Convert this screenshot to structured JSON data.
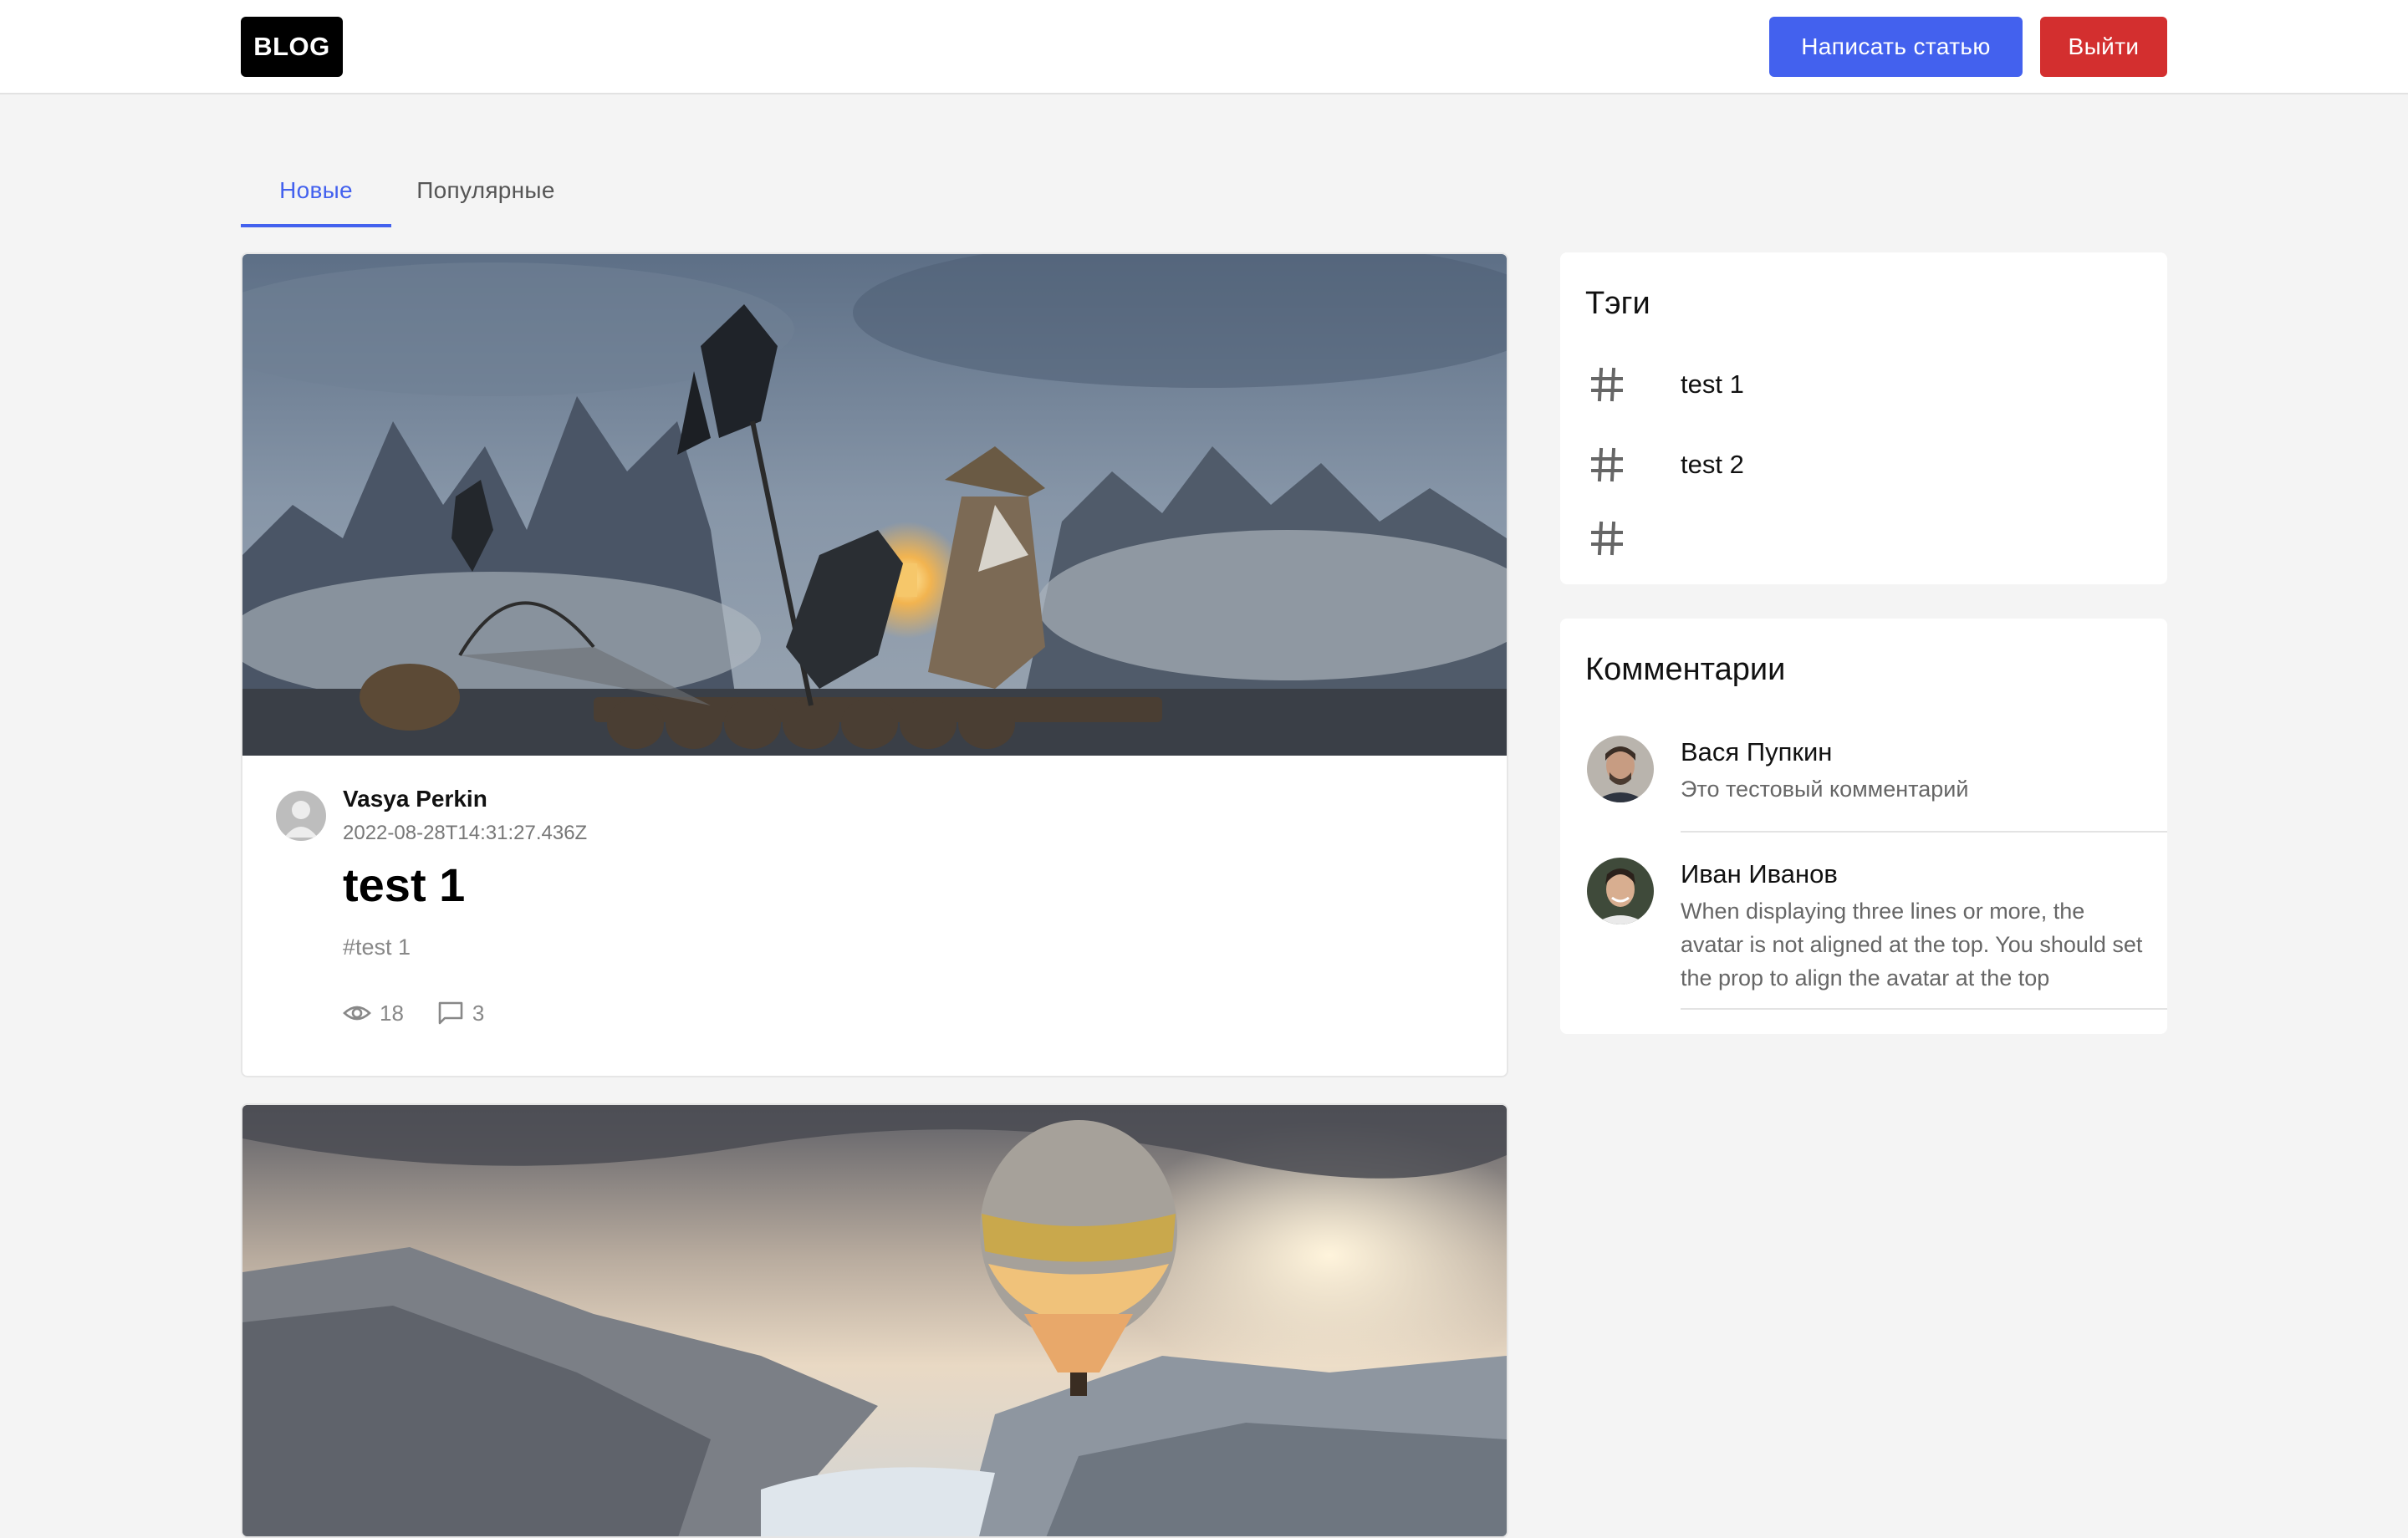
{
  "colors": {
    "accent": "#4361ee",
    "danger": "#d32f2f",
    "page_bg": "#f4f4f4",
    "card_bg": "#ffffff"
  },
  "header": {
    "logo": "BLOG",
    "write_button": "Написать статью",
    "logout_button": "Выйти"
  },
  "tabs": [
    {
      "label": "Новые",
      "active": true
    },
    {
      "label": "Популярные",
      "active": false
    }
  ],
  "posts": [
    {
      "author": "Vasya Perkin",
      "date": "2022-08-28T14:31:27.436Z",
      "title": "test 1",
      "tag": "#test 1",
      "views": "18",
      "comments": "3",
      "image": "fisherman-with-cormorants-photo"
    },
    {
      "image": "hot-air-balloon-over-canyon-photo"
    }
  ],
  "sidebar": {
    "tags_title": "Тэги",
    "tags": [
      {
        "icon": "hash-icon",
        "label": "test 1"
      },
      {
        "icon": "hash-icon",
        "label": "test 2"
      },
      {
        "icon": "hash-icon",
        "label": ""
      }
    ],
    "comments_title": "Комментарии",
    "comments": [
      {
        "name": "Вася Пупкин",
        "text": "Это тестовый комментарий"
      },
      {
        "name": "Иван Иванов",
        "text": "When displaying three lines or more, the avatar is not aligned at the top. You should set the prop to align the avatar at the top"
      }
    ]
  }
}
